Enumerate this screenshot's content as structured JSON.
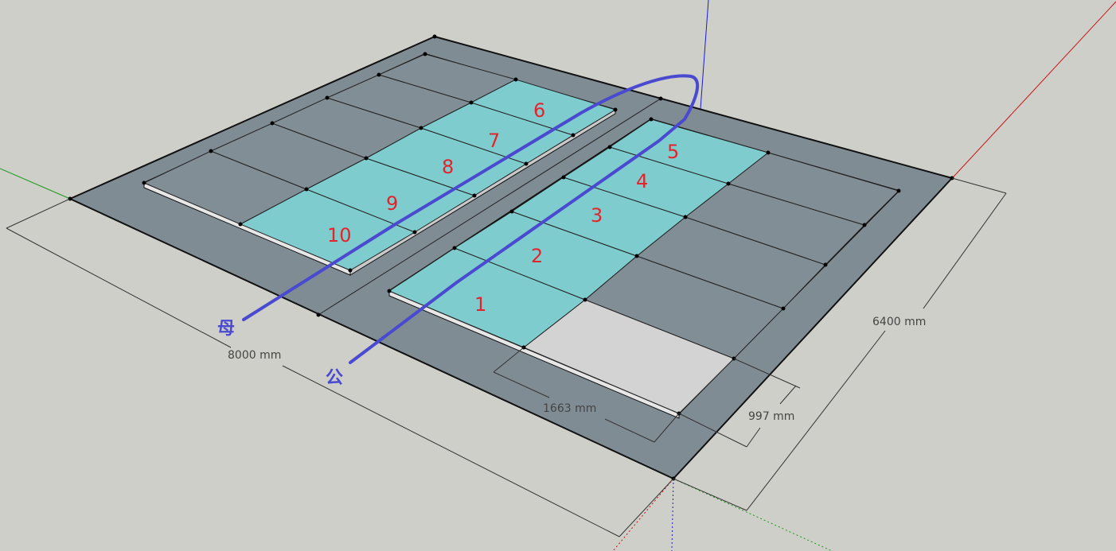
{
  "colors": {
    "background": "#cfcfca",
    "base_plate": "#7f8c94",
    "grey_panel": "#818e96",
    "cyan_panel": "#7fcccf",
    "white_panel": "#d3d3d3",
    "panel_label": "#e3242b",
    "cable": "#4a4ad0",
    "axis_red": "#cc1111",
    "axis_green": "#1a9a1a",
    "axis_blue": "#1a1ad8"
  },
  "dimensions": {
    "width_label": "8000 mm",
    "depth_label": "6400 mm",
    "panel_length_label": "1663 mm",
    "panel_width_label": "997 mm"
  },
  "panels": {
    "right_array": [
      "1",
      "2",
      "3",
      "4",
      "5"
    ],
    "left_array": [
      "6",
      "7",
      "8",
      "9",
      "10"
    ]
  },
  "wiring": {
    "female_label": "母",
    "male_label": "公"
  }
}
